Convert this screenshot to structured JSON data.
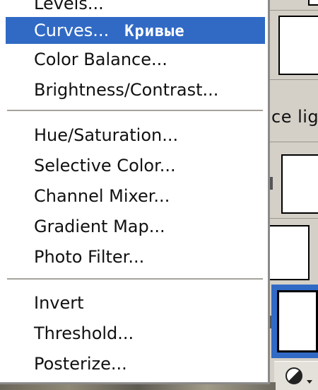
{
  "menu": {
    "items": [
      {
        "label": "Levels..."
      },
      {
        "label": "Curves...",
        "translation": "Кривые",
        "selected": true
      },
      {
        "label": "Color Balance..."
      },
      {
        "label": "Brightness/Contrast..."
      },
      {
        "label": "Hue/Saturation..."
      },
      {
        "label": "Selective Color..."
      },
      {
        "label": "Channel Mixer..."
      },
      {
        "label": "Gradient Map..."
      },
      {
        "label": "Photo Filter..."
      },
      {
        "label": "Invert"
      },
      {
        "label": "Threshold..."
      },
      {
        "label": "Posterize..."
      }
    ]
  },
  "background": {
    "peek_text": "ce ligh",
    "icons": [
      "layer-thumbnail",
      "link-chain-icon",
      "half-circle-adjustment-icon",
      "dropdown-arrow-icon"
    ]
  },
  "colors": {
    "highlight": "#316ac5",
    "menu_bg": "#ffffff",
    "panel_bg": "#d4d0c8"
  }
}
